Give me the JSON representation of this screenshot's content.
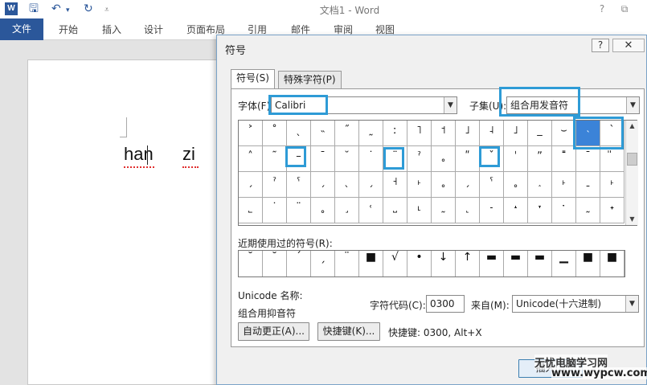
{
  "app": {
    "logo": "W",
    "title": "文档1 - Word",
    "qat_icons": [
      "save-icon",
      "undo-icon",
      "redo-icon",
      "customize-icon"
    ],
    "window_buttons": [
      "?",
      "⧉"
    ]
  },
  "ribbon_tabs": [
    {
      "label": "文件"
    },
    {
      "label": "开始"
    },
    {
      "label": "插入"
    },
    {
      "label": "设计"
    },
    {
      "label": "页面布局"
    },
    {
      "label": "引用"
    },
    {
      "label": "邮件"
    },
    {
      "label": "审阅"
    },
    {
      "label": "视图"
    }
  ],
  "document": {
    "text_1": "han",
    "text_2": "zi"
  },
  "dialog": {
    "title": "符号",
    "help": "?",
    "close": "✕",
    "tab_symbols": "符号(S)",
    "tab_special": "特殊字符(P)",
    "font_label": "字体(F):",
    "font_value": "Calibri",
    "subset_label": "子集(U):",
    "subset_value": "组合用发音符",
    "symbol_rows": [
      [
        "˃",
        "˚",
        "ˎ",
        "˵",
        "˝",
        "˷",
        "ː",
        "˥",
        "˦",
        "˩",
        "˨",
        "˩",
        "_",
        "⌣",
        "˴",
        "ˋ",
        "ˊ"
      ],
      [
        "˄",
        "˜",
        "–",
        "¯",
        "˘",
        "˙",
        "¨",
        "ˀ",
        "˳",
        "ʺ",
        "ˇ",
        "ˈ",
        "ˮ",
        "˭",
        "ˉ",
        "̎",
        "̈"
      ],
      [
        "ˏ",
        "ˀ",
        "ˁ",
        "ˏ",
        "ˎ",
        "ˏ",
        "˧",
        "˫",
        "˳",
        "ˏ",
        "ˁ",
        "˳",
        "˰",
        "˫",
        "ˍ",
        "˫",
        "˗"
      ],
      [
        "˾",
        "˙",
        "¨",
        "˳",
        "˼",
        "˓",
        "˽",
        "˪",
        "˷",
        "˻",
        "˗",
        "˔",
        "˕",
        "ˑ",
        "˷",
        "˖",
        "˷"
      ]
    ],
    "selected_symbol": "ˋ",
    "recent_label": "近期使用过的符号(R):",
    "recent_symbols": [
      "˘",
      "˘",
      "ˊ",
      "ˏ",
      "¨",
      "■",
      "√",
      "•",
      "↓",
      "↑",
      "▬",
      "▬",
      "▬",
      "▁",
      "■",
      "■"
    ],
    "unicode_name_label": "Unicode 名称:",
    "unicode_name_value": "组合用抑音符",
    "char_code_label": "字符代码(C):",
    "char_code_value": "0300",
    "from_label": "来自(M):",
    "from_value": "Unicode(十六进制)",
    "autocorrect_button": "自动更正(A)...",
    "shortcut_button": "快捷键(K)...",
    "shortcut_text": "快捷键: 0300, Alt+X",
    "insert_button": "插入(I)"
  },
  "watermark": {
    "line1": "无忧电脑学习网",
    "line2": "www.wypcw.com"
  },
  "colors": {
    "accent": "#2b579a",
    "highlight": "#2e9bd6",
    "selected_cell": "#3b83d8"
  }
}
